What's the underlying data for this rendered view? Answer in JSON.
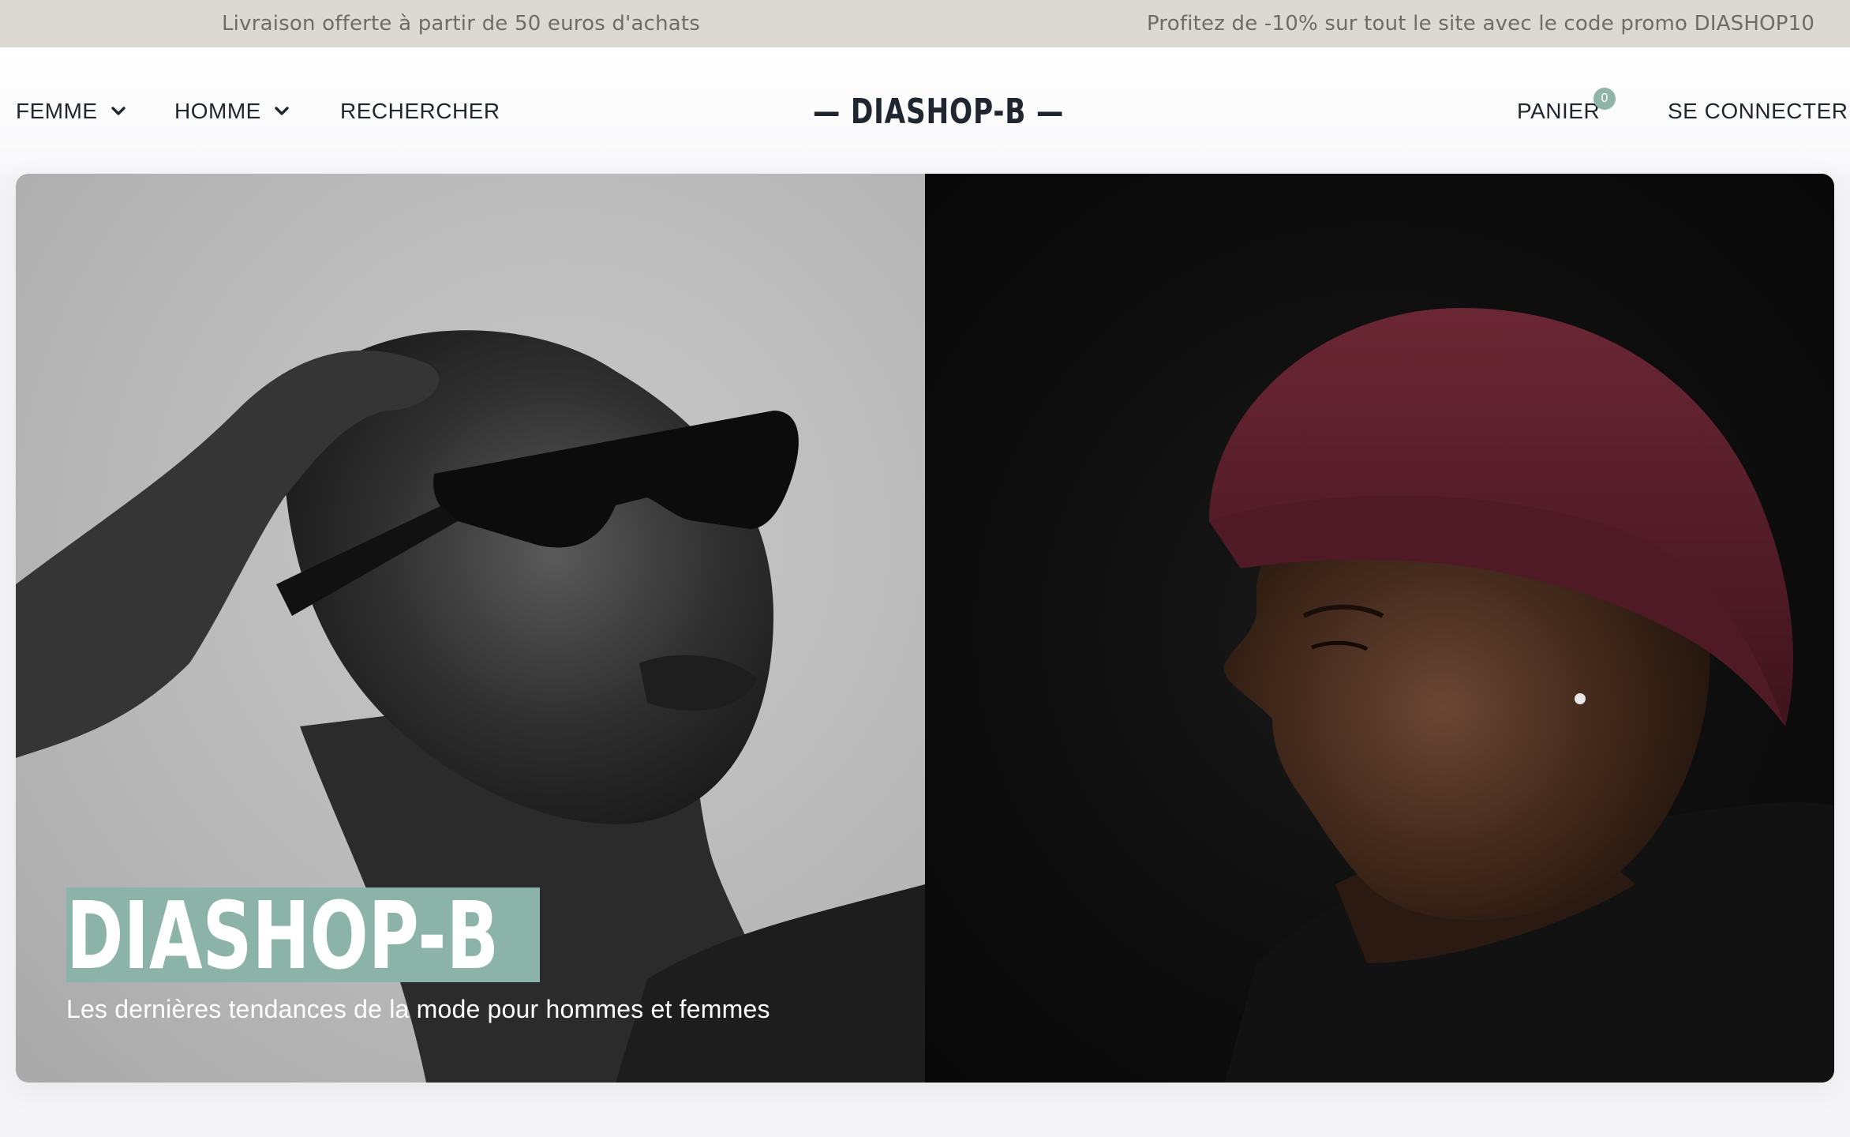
{
  "topbar": {
    "promo_left": "Livraison offerte à partir de 50 euros d'achats",
    "promo_right": "Profitez de -10% sur tout le site avec le code promo DIASHOP10"
  },
  "header": {
    "nav_femme": "FEMME",
    "nav_homme": "HOMME",
    "nav_search": "RECHERCHER",
    "logo": "— DIASHOP-B —",
    "cart_label": "PANIER",
    "cart_count": "0",
    "login_label": "SE CONNECTER"
  },
  "hero": {
    "title": "DIASHOP-B",
    "subtitle": "Les dernières tendances de la mode pour hommes et femmes"
  },
  "colors": {
    "accent": "#8cb3a7",
    "topbar_bg": "#dcd9d2",
    "text": "#1f2630",
    "beanie": "#5a1f2a"
  }
}
